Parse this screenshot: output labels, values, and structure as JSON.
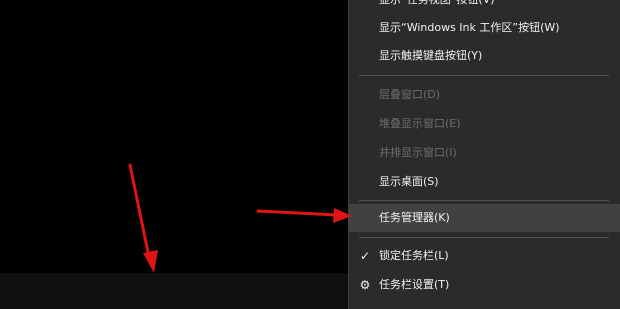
{
  "colors": {
    "background": "#000000",
    "taskbar": "#101010",
    "menu_background": "#2b2b2b",
    "menu_hover": "#414141",
    "text": "#f2f2f2",
    "disabled_text": "#6d6d6d",
    "separator": "#545454",
    "annotation_arrow": "#e11414"
  },
  "context_menu": {
    "items": [
      {
        "label": "显示“任务视图”按钮(V)",
        "enabled": true,
        "checked": false
      },
      {
        "label": "显示“Windows Ink 工作区”按钮(W)",
        "enabled": true,
        "checked": false
      },
      {
        "label": "显示触摸键盘按钮(Y)",
        "enabled": true,
        "checked": false
      },
      {
        "label": "层叠窗口(D)",
        "enabled": false,
        "checked": false
      },
      {
        "label": "堆叠显示窗口(E)",
        "enabled": false,
        "checked": false
      },
      {
        "label": "并排显示窗口(I)",
        "enabled": false,
        "checked": false
      },
      {
        "label": "显示桌面(S)",
        "enabled": true,
        "checked": false
      },
      {
        "label": "任务管理器(K)",
        "enabled": true,
        "checked": false,
        "highlighted": true
      },
      {
        "label": "锁定任务栏(L)",
        "enabled": true,
        "checked": true,
        "icon": "checkmark-icon",
        "glyph": "✓"
      },
      {
        "label": "任务栏设置(T)",
        "enabled": true,
        "checked": false,
        "icon": "gear-icon",
        "glyph": "⚙"
      }
    ]
  },
  "annotations": {
    "arrows": [
      "arrow-to-taskbar",
      "arrow-to-task-manager"
    ]
  }
}
